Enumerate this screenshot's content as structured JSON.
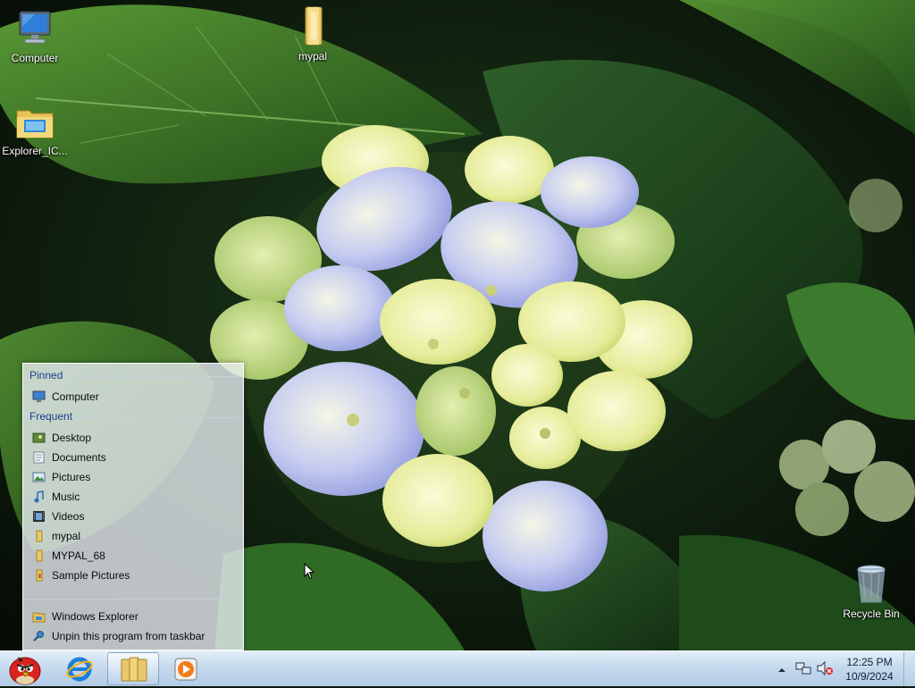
{
  "desktop": {
    "icons": [
      {
        "label": "Computer",
        "icon": "computer-icon"
      },
      {
        "label": "mypal",
        "icon": "folder-icon"
      },
      {
        "label": "Explorer_IC...",
        "icon": "explorer-folder-icon"
      },
      {
        "label": "Recycle Bin",
        "icon": "recycle-bin-icon"
      }
    ]
  },
  "jumplist": {
    "pinned_header": "Pinned",
    "pinned": [
      {
        "label": "Computer",
        "icon": "computer-icon"
      }
    ],
    "frequent_header": "Frequent",
    "frequent": [
      {
        "label": "Desktop",
        "icon": "desktop-icon"
      },
      {
        "label": "Documents",
        "icon": "documents-icon"
      },
      {
        "label": "Pictures",
        "icon": "pictures-icon"
      },
      {
        "label": "Music",
        "icon": "music-icon"
      },
      {
        "label": "Videos",
        "icon": "videos-icon"
      },
      {
        "label": "mypal",
        "icon": "folder-icon"
      },
      {
        "label": "MYPAL_68",
        "icon": "folder-icon"
      },
      {
        "label": "Sample Pictures",
        "icon": "folder-icon"
      }
    ],
    "tasks": [
      {
        "label": "Windows Explorer",
        "icon": "explorer-icon"
      },
      {
        "label": "Unpin this program from taskbar",
        "icon": "unpin-icon"
      }
    ]
  },
  "taskbar": {
    "buttons": [
      {
        "name": "start-button",
        "icon": "angry-bird-start-icon"
      },
      {
        "name": "internet-explorer",
        "icon": "ie-icon"
      },
      {
        "name": "windows-explorer",
        "icon": "folders-icon",
        "active": true
      },
      {
        "name": "media-player",
        "icon": "media-player-icon"
      }
    ],
    "tray": {
      "icons": [
        "show-hidden-icons-chevron",
        "network-icon",
        "volume-muted-icon"
      ]
    },
    "clock": {
      "time": "12:25 PM",
      "date": "10/9/2024"
    }
  },
  "colors": {
    "taskbar_top": "#e2eef9",
    "taskbar_bottom": "#b2cbe6",
    "jumplist_header": "#1e3f8a",
    "accent_active": "#5a78a0"
  }
}
